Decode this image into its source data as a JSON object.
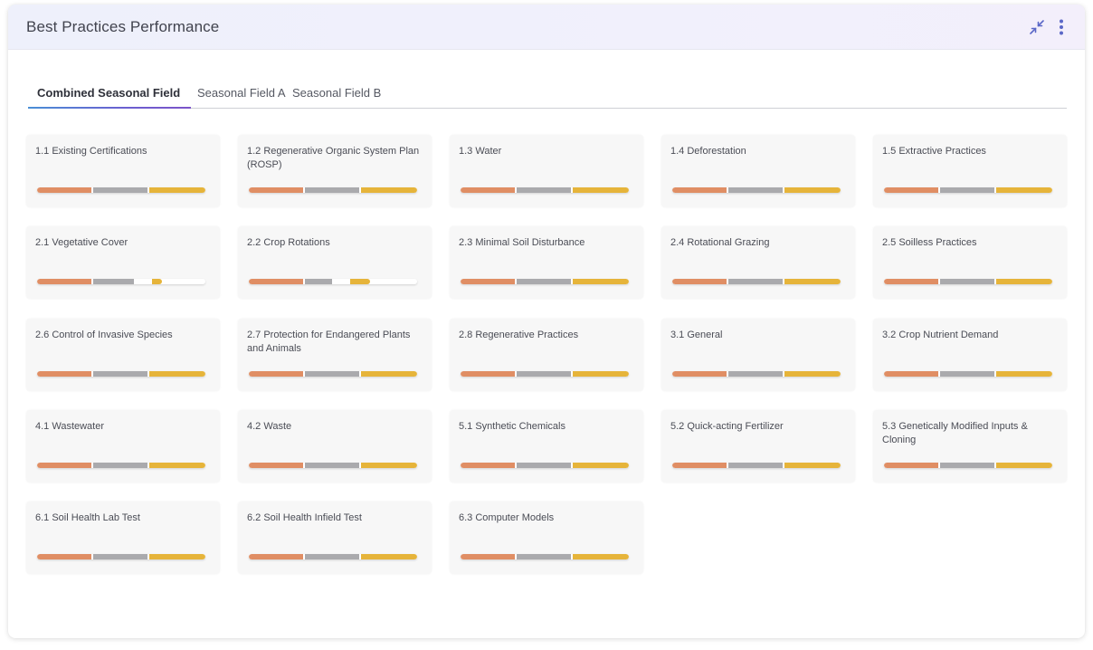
{
  "panel": {
    "title": "Best Practices Performance",
    "icons": {
      "collapse": "collapse-arrows-icon",
      "more": "more-vertical-icon"
    },
    "accent_color": "#5a67c7"
  },
  "tabs": [
    {
      "label": "Combined Seasonal Field",
      "active": true
    },
    {
      "label": "Seasonal Field A",
      "active": false
    },
    {
      "label": "Seasonal Field B",
      "active": false
    }
  ],
  "colors": {
    "orange": "#e08e64",
    "gray": "#aaaaad",
    "yellow": "#e6b43a"
  },
  "cards": [
    {
      "label": "1.1 Existing Certifications",
      "segments": [
        0.333,
        0.333,
        0.334
      ]
    },
    {
      "label": "1.2 Regenerative Organic System Plan (ROSP)",
      "segments": [
        0.333,
        0.333,
        0.334
      ]
    },
    {
      "label": "1.3 Water",
      "segments": [
        0.333,
        0.333,
        0.334
      ]
    },
    {
      "label": "1.4 Deforestation",
      "segments": [
        0.333,
        0.333,
        0.334
      ]
    },
    {
      "label": "1.5 Extractive Practices",
      "segments": [
        0.333,
        0.333,
        0.334
      ]
    },
    {
      "label": "2.1 Vegetative Cover",
      "segments": [
        0.333,
        0.25,
        0.06
      ]
    },
    {
      "label": "2.2 Crop Rotations",
      "segments": [
        0.333,
        0.17,
        0.12
      ]
    },
    {
      "label": "2.3 Minimal Soil Disturbance",
      "segments": [
        0.333,
        0.333,
        0.334
      ]
    },
    {
      "label": "2.4 Rotational Grazing",
      "segments": [
        0.333,
        0.333,
        0.334
      ]
    },
    {
      "label": "2.5 Soilless Practices",
      "segments": [
        0.333,
        0.333,
        0.334
      ]
    },
    {
      "label": "2.6 Control of Invasive Species",
      "segments": [
        0.333,
        0.333,
        0.334
      ]
    },
    {
      "label": "2.7 Protection for Endangered Plants and Animals",
      "segments": [
        0.333,
        0.333,
        0.334
      ]
    },
    {
      "label": "2.8 Regenerative Practices",
      "segments": [
        0.333,
        0.333,
        0.334
      ]
    },
    {
      "label": "3.1 General",
      "segments": [
        0.333,
        0.333,
        0.334
      ]
    },
    {
      "label": "3.2 Crop Nutrient Demand",
      "segments": [
        0.333,
        0.333,
        0.334
      ]
    },
    {
      "label": "4.1 Wastewater",
      "segments": [
        0.333,
        0.333,
        0.334
      ]
    },
    {
      "label": "4.2 Waste",
      "segments": [
        0.333,
        0.333,
        0.334
      ]
    },
    {
      "label": "5.1 Synthetic Chemicals",
      "segments": [
        0.333,
        0.333,
        0.334
      ]
    },
    {
      "label": "5.2 Quick-acting Fertilizer",
      "segments": [
        0.333,
        0.333,
        0.334
      ]
    },
    {
      "label": "5.3 Genetically Modified Inputs & Cloning",
      "segments": [
        0.333,
        0.333,
        0.334
      ]
    },
    {
      "label": "6.1 Soil Health Lab Test",
      "segments": [
        0.333,
        0.333,
        0.334
      ]
    },
    {
      "label": "6.2 Soil Health Infield Test",
      "segments": [
        0.333,
        0.333,
        0.334
      ]
    },
    {
      "label": "6.3 Computer Models",
      "segments": [
        0.333,
        0.333,
        0.334
      ]
    }
  ]
}
